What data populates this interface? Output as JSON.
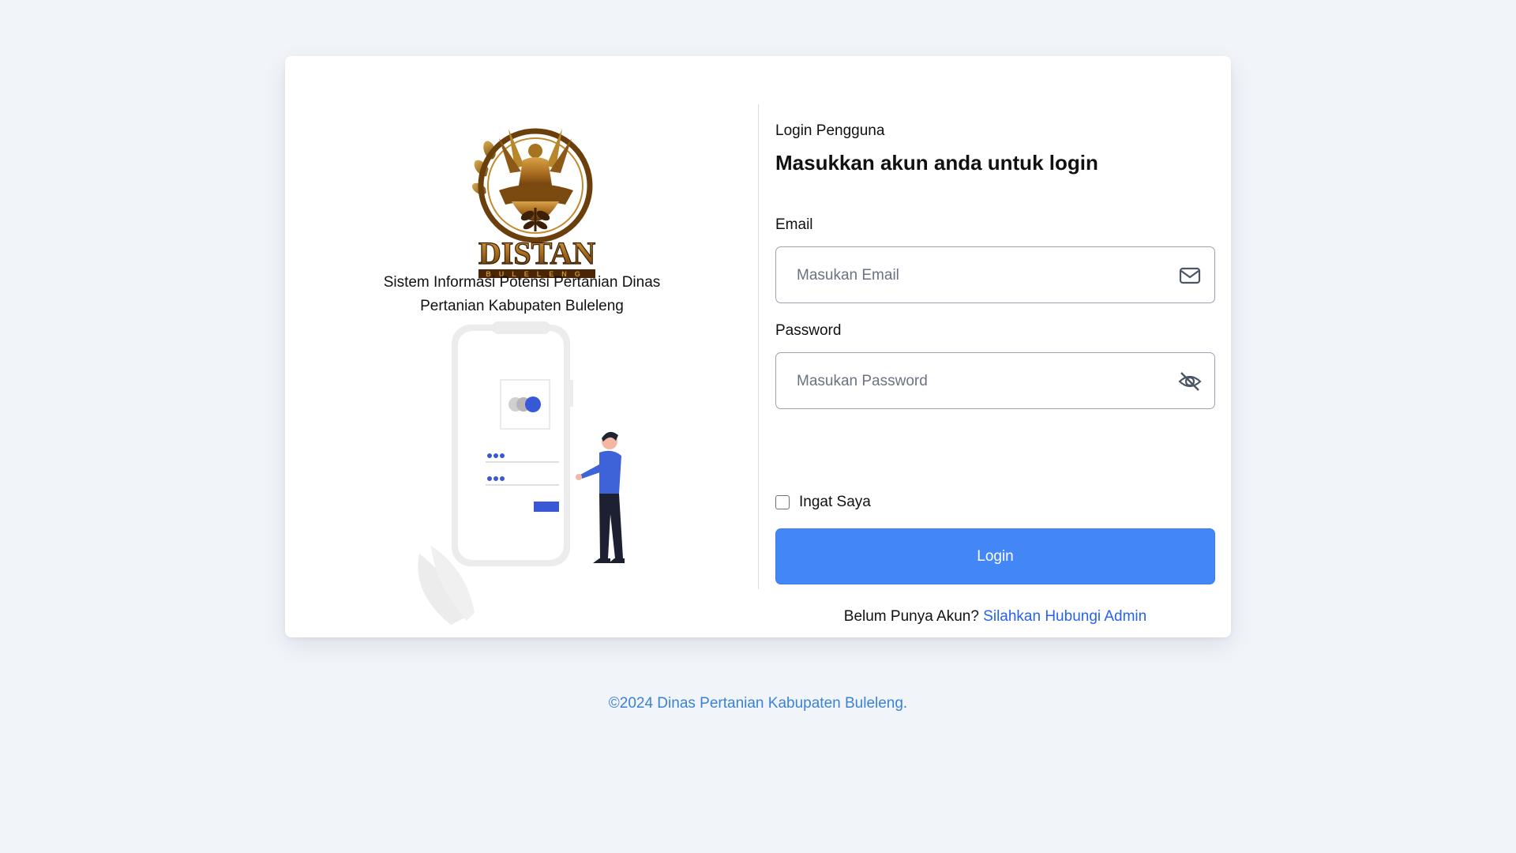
{
  "brand": {
    "logo_text": "DISTAN",
    "logo_subtext": "BULELENG",
    "tagline": "Sistem Informasi Potensi Pertanian Dinas Pertanian Kabupaten Buleleng"
  },
  "form": {
    "pre_title": "Login Pengguna",
    "title": "Masukkan akun anda untuk login",
    "email_label": "Email",
    "email_placeholder": "Masukan Email",
    "email_value": "",
    "password_label": "Password",
    "password_placeholder": "Masukan Password",
    "password_value": "",
    "remember_label": "Ingat Saya",
    "remember_checked": false,
    "login_button": "Login",
    "signup_prompt": "Belum Punya Akun?",
    "signup_link": "Silahkan Hubungi Admin"
  },
  "footer": {
    "copyright": "©2024 Dinas Pertanian Kabupaten Buleleng."
  },
  "icons": {
    "email": "envelope-icon",
    "password": "eye-slash-icon"
  },
  "colors": {
    "page_background": "#f1f4f9",
    "primary_button": "#4287f5",
    "link": "#2563eb",
    "footer_text": "#3b82d6",
    "illustration_accent": "#3858d6"
  }
}
